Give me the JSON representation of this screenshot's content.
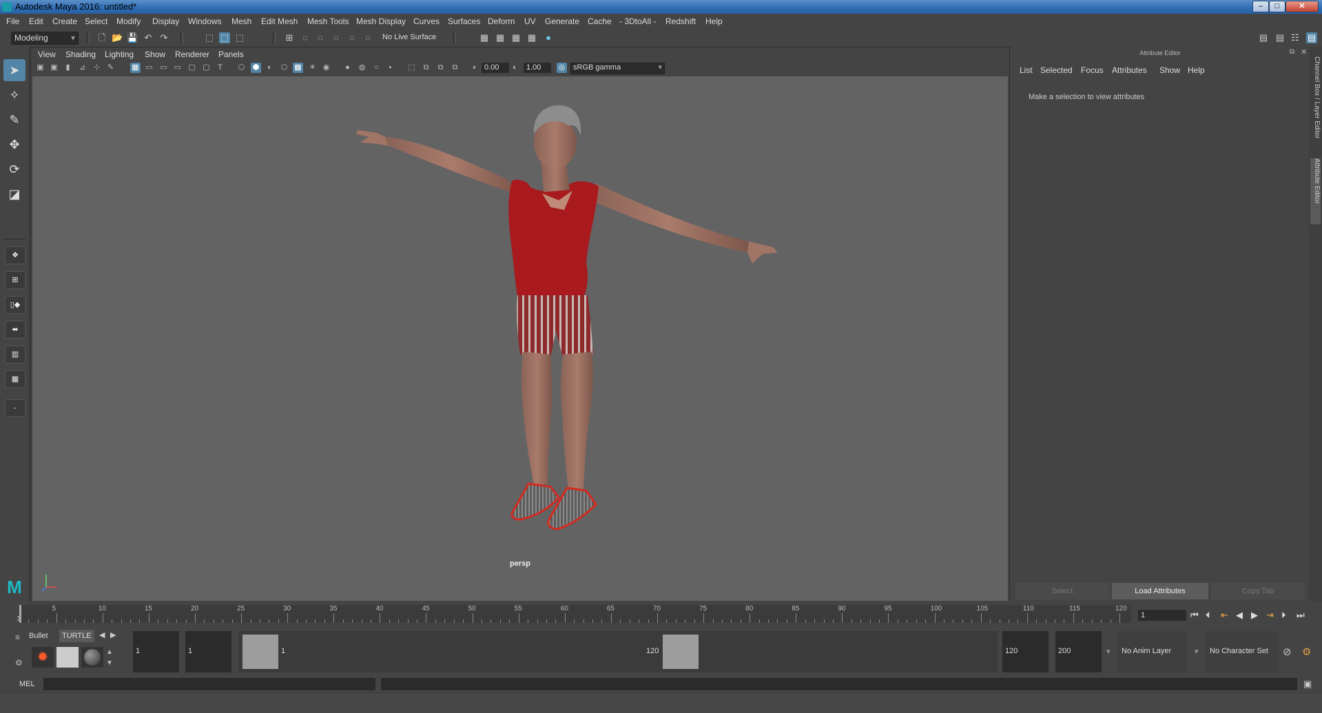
{
  "window": {
    "title": "Autodesk Maya 2016: untitled*",
    "buttons": [
      "–",
      "□",
      "✕"
    ]
  },
  "menus": [
    "File",
    "Edit",
    "Create",
    "Select",
    "Modify",
    "Display",
    "Windows",
    "Mesh",
    "Edit Mesh",
    "Mesh Tools",
    "Mesh Display",
    "Curves",
    "Surfaces",
    "Deform",
    "UV",
    "Generate",
    "Cache",
    "- 3DtoAll -",
    "Redshift",
    "Help"
  ],
  "statusline": {
    "menuset": "Modeling",
    "live_surface": "No Live Surface"
  },
  "viewport": {
    "menus": [
      "View",
      "Shading",
      "Lighting",
      "Show",
      "Renderer",
      "Panels"
    ],
    "field_exposure": "0.00",
    "field_gamma": "1.00",
    "colorspace": "sRGB gamma",
    "camera_label": "persp"
  },
  "attribute_editor": {
    "header": "Attribute Editor",
    "menus": [
      "List",
      "Selected",
      "Focus",
      "Attributes",
      "Show",
      "Help"
    ],
    "message": "Make a selection to view attributes",
    "buttons": {
      "select": "Select",
      "load": "Load Attributes",
      "copy": "Copy Tab"
    }
  },
  "side_tabs": {
    "channel_box": "Channel Box / Layer Editor",
    "attribute_editor": "Attribute Editor"
  },
  "timeslider": {
    "ticks": [
      "1",
      "5",
      "10",
      "15",
      "20",
      "25",
      "30",
      "35",
      "40",
      "45",
      "50",
      "55",
      "60",
      "65",
      "70",
      "75",
      "80",
      "85",
      "90",
      "95",
      "100",
      "105",
      "110",
      "115",
      "120"
    ],
    "current_frame": "1"
  },
  "rangeslider": {
    "shelf_tabs": [
      "Bullet",
      "TURTLE"
    ],
    "start": "1",
    "playback_start": "1",
    "range_start_label": "1",
    "range_end_label": "120",
    "playback_end": "120",
    "end": "200",
    "anim_layer": "No Anim Layer",
    "character_set": "No Character Set"
  },
  "cmdline": {
    "label": "MEL"
  },
  "colors": {
    "accent": "#5285a6",
    "viewport_bg": "#636363",
    "shirt": "#a81a1d"
  }
}
